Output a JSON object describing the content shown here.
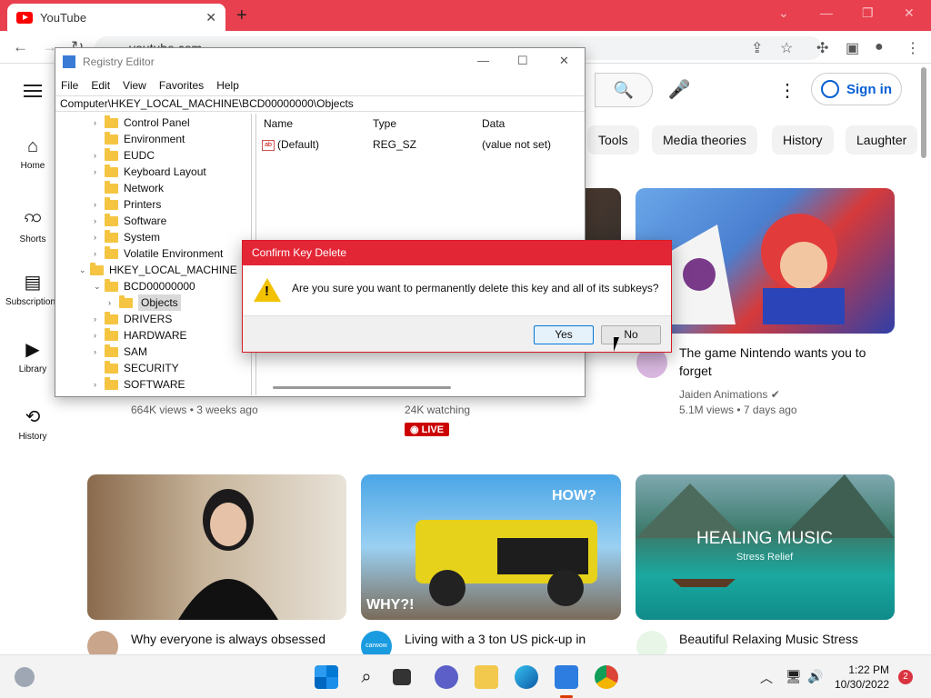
{
  "browser": {
    "tab_title": "YouTube",
    "url": "youtube.com"
  },
  "youtube": {
    "signin_label": "Sign in",
    "guide": [
      {
        "label": "Home",
        "icon": "home-icon"
      },
      {
        "label": "Shorts",
        "icon": "shorts-icon"
      },
      {
        "label": "Subscriptions",
        "icon": "subscriptions-icon"
      },
      {
        "label": "Library",
        "icon": "library-icon"
      },
      {
        "label": "History",
        "icon": "history-icon"
      }
    ],
    "chips": [
      "Tools",
      "Media theories",
      "History",
      "Laughter"
    ],
    "row1": [
      {
        "meta": "664K views • 3 weeks ago"
      },
      {
        "meta": "24K watching",
        "badge": "LIVE"
      },
      {
        "title": "The game Nintendo wants you to forget",
        "channel": "Jaiden Animations",
        "meta": "5.1M views • 7 days ago"
      }
    ],
    "row2": [
      {
        "title": "Why everyone is always obsessed"
      },
      {
        "title": "Living with a 3 ton US pick-up in",
        "avatar_text": "carwow",
        "overlay_top": "HOW?",
        "overlay_bottom": "WHY?!"
      },
      {
        "title": "Beautiful Relaxing Music Stress",
        "overlay_main": "HEALING MUSIC",
        "overlay_sub": "Stress Relief"
      }
    ]
  },
  "regedit": {
    "title": "Registry Editor",
    "menu": [
      "File",
      "Edit",
      "View",
      "Favorites",
      "Help"
    ],
    "address": "Computer\\HKEY_LOCAL_MACHINE\\BCD00000000\\Objects",
    "tree": [
      {
        "label": "Control Panel",
        "level": 2,
        "arrow": ">"
      },
      {
        "label": "Environment",
        "level": 2,
        "arrow": ""
      },
      {
        "label": "EUDC",
        "level": 2,
        "arrow": ">"
      },
      {
        "label": "Keyboard Layout",
        "level": 2,
        "arrow": ">"
      },
      {
        "label": "Network",
        "level": 2,
        "arrow": ""
      },
      {
        "label": "Printers",
        "level": 2,
        "arrow": ">"
      },
      {
        "label": "Software",
        "level": 2,
        "arrow": ">"
      },
      {
        "label": "System",
        "level": 2,
        "arrow": ">"
      },
      {
        "label": "Volatile Environment",
        "level": 2,
        "arrow": ">"
      },
      {
        "label": "HKEY_LOCAL_MACHINE",
        "level": 1,
        "arrow": "v"
      },
      {
        "label": "BCD00000000",
        "level": 2,
        "arrow": "v"
      },
      {
        "label": "Objects",
        "level": 3,
        "arrow": ">",
        "selected": true
      },
      {
        "label": "DRIVERS",
        "level": 2,
        "arrow": ">"
      },
      {
        "label": "HARDWARE",
        "level": 2,
        "arrow": ">"
      },
      {
        "label": "SAM",
        "level": 2,
        "arrow": ">"
      },
      {
        "label": "SECURITY",
        "level": 2,
        "arrow": ""
      },
      {
        "label": "SOFTWARE",
        "level": 2,
        "arrow": ">"
      }
    ],
    "columns": [
      "Name",
      "Type",
      "Data"
    ],
    "values": [
      {
        "name": "(Default)",
        "type": "REG_SZ",
        "data": "(value not set)",
        "icon": "ab"
      }
    ]
  },
  "dialog": {
    "title": "Confirm Key Delete",
    "message": "Are you sure you want to permanently delete this key and all of its subkeys?",
    "yes": "Yes",
    "no": "No"
  },
  "taskbar": {
    "time": "1:22 PM",
    "date": "10/30/2022",
    "notifications": "2"
  }
}
